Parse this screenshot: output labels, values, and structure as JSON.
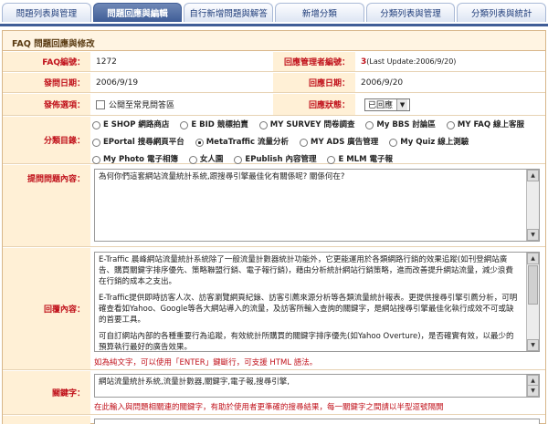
{
  "tabs": [
    {
      "label": "問題列表與管理",
      "active": false
    },
    {
      "label": "問題回應與編輯",
      "active": true
    },
    {
      "label": "自行新增問題與解答",
      "active": false
    },
    {
      "label": "新增分類",
      "active": false
    },
    {
      "label": "分類列表與管理",
      "active": false
    },
    {
      "label": "分類列表與統計",
      "active": false
    }
  ],
  "panel_title": "FAQ 問題回應與修改",
  "fields": {
    "faq_id_label": "FAQ編號：",
    "faq_id_value": "1272",
    "manager_id_label": "回應管理者編號：",
    "manager_id_value": "3",
    "manager_update": "(Last Update:2006/9/20)",
    "ask_date_label": "發問日期：",
    "ask_date_value": "2006/9/19",
    "reply_date_label": "回應日期：",
    "reply_date_value": "2006/9/20",
    "publish_label": "發佈選項：",
    "publish_option": "公開至常見問答區",
    "status_label": "回應狀態：",
    "status_value": "已回應",
    "category_label": "分類目錄：",
    "question_label": "提問問題內容：",
    "question_text": "為何你們這套網站流量統計系統,跟搜尋引擎最佳化有關係呢? 關係何在?",
    "answer_label": "回覆內容：",
    "answer_paragraphs": [
      "E-Traffic 晨峰網站流量統計系統除了一般流量計數器統計功能外，它更能運用於各類網路行銷的效果追蹤(如刊登網站廣告、購買關鍵字排序優先、策略聯盟行銷、電子報行銷)，藉由分析統計網站行銷策略，進而改善提升網站流量，減少浪費在行銷的成本之支出。",
      "E-Traffic提供即時訪客人次、訪客瀏覽網頁紀錄、訪客引薦來源分析等各類流量統計報表。更提供搜尋引擎引薦分析，可明確查看如Yahoo、Google等各大網站導入的流量，及訪客所輸入查詢的關鍵字，是網站搜尋引擎最佳化執行成效不可或缺的首要工具。",
      "可自訂網站內部的各種重要行為追蹤，有效統計所購買的關鍵字排序優先(如Yahoo Overture)，是否確實有效，以最少的預算執行最好的廣告效果。"
    ],
    "answer_hint": "如為純文字，可以使用「ENTER」鍵斷行，可支援 HTML 語法。",
    "keyword_label": "關鍵字：",
    "keyword_text": "網站流量統計系統,流量計數器,關鍵字,電子報,搜尋引擎,",
    "keyword_hint": "在此輸入與問題相關連的關鍵字，有助於使用者更準確的搜尋結果，每一關鍵字之間請以半型逗號隔開"
  },
  "categories": [
    {
      "label": "E SHOP 網路商店",
      "checked": false
    },
    {
      "label": "E BID 競標拍賣",
      "checked": false
    },
    {
      "label": "MY SURVEY 問卷調查",
      "checked": false
    },
    {
      "label": "My BBS 討論區",
      "checked": false
    },
    {
      "label": "MY FAQ 線上客服",
      "checked": false
    },
    {
      "label": "EPortal 搜尋網頁平台",
      "checked": false
    },
    {
      "label": "MetaTraffic 流量分析",
      "checked": true
    },
    {
      "label": "MY ADS 廣告管理",
      "checked": false
    },
    {
      "label": "My Quiz 線上測驗",
      "checked": false
    },
    {
      "label": "My Photo 電子相簿",
      "checked": false
    },
    {
      "label": "女人園",
      "checked": false
    },
    {
      "label": "EPublish 內容管理",
      "checked": false
    },
    {
      "label": "E MLM 電子報",
      "checked": false
    }
  ],
  "colors": {
    "accent": "#3f5d97",
    "label_bg": "#fff0d6",
    "label_text": "#c0101a"
  }
}
